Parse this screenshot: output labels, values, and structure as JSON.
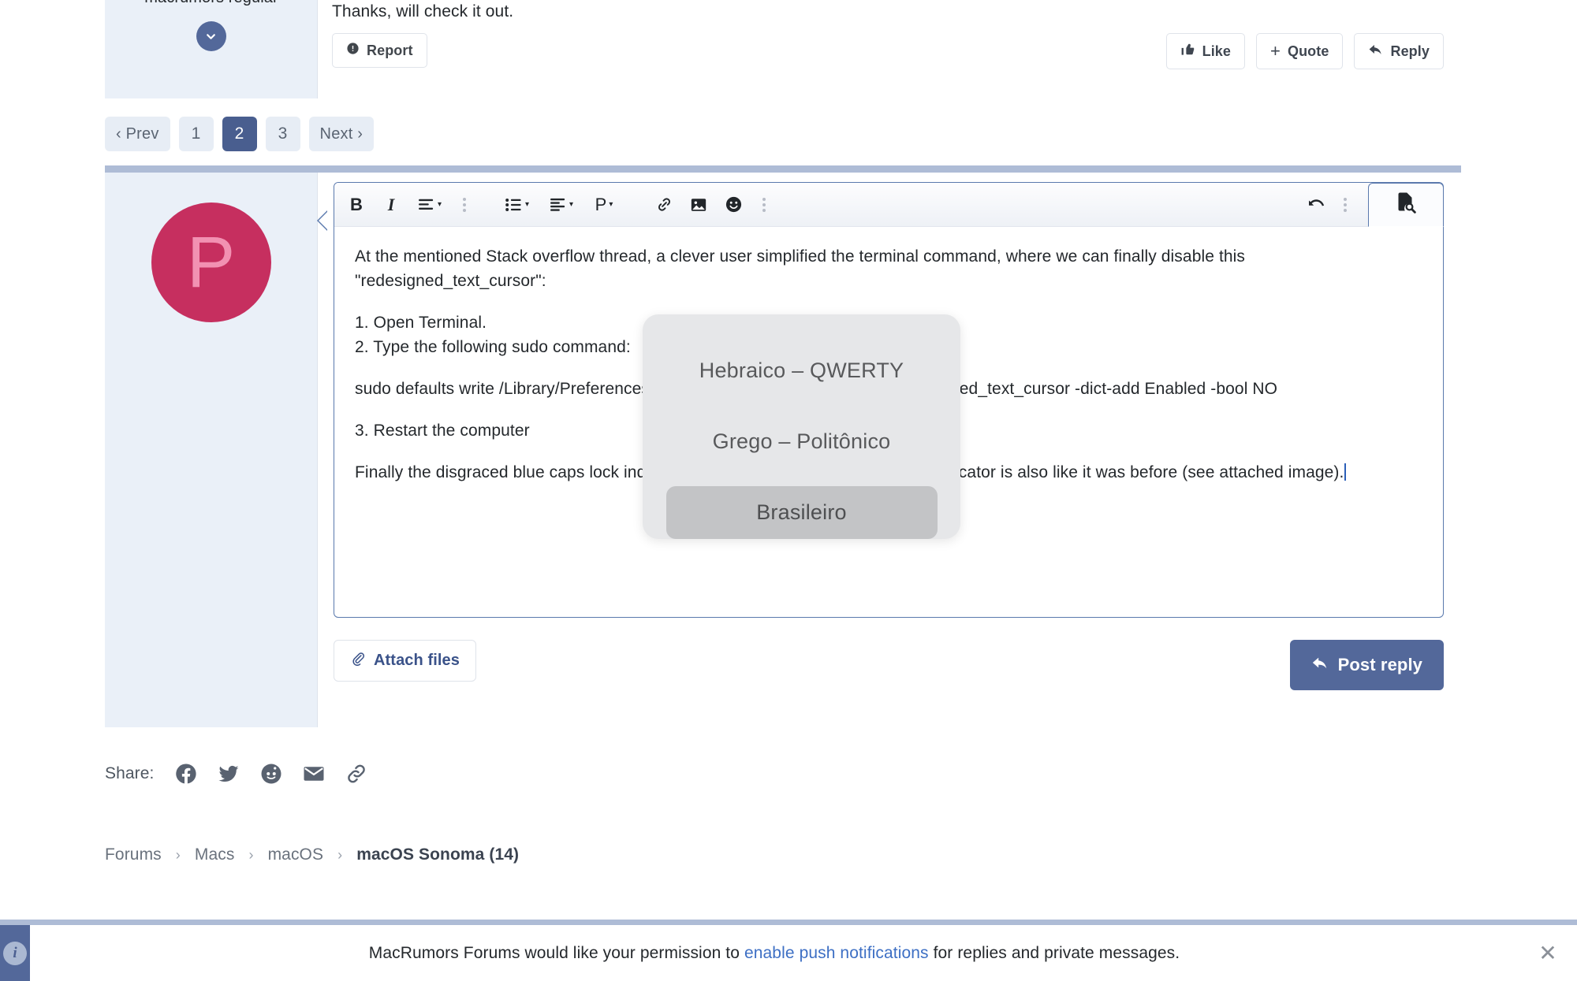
{
  "previous_post": {
    "username_clipped": "macrumors regular",
    "expand_icon": "chevron-down-icon",
    "body_text": "Thanks, will check it out.",
    "report_label": "Report",
    "report_icon": "exclamation-circle-icon",
    "actions": [
      {
        "label": "Like",
        "icon": "thumbs-up-icon"
      },
      {
        "label": "Quote",
        "icon": "plus-icon"
      },
      {
        "label": "Reply",
        "icon": "reply-arrow-icon"
      }
    ]
  },
  "pagination": {
    "prev_label": "‹ Prev",
    "pages": [
      "1",
      "2",
      "3"
    ],
    "current_page": "2",
    "next_label": "Next ›"
  },
  "reply": {
    "avatar_letter": "P",
    "avatar_bg": "#c62f5f",
    "avatar_fg": "#f291b2",
    "toolbar": {
      "bold": "B",
      "italic": "I",
      "bold_name": "bold-button",
      "italic_name": "italic-button",
      "text_format_icon": "text-lines-dropdown-icon",
      "more_left_icon": "more-options-icon",
      "list_icon": "bullet-list-dropdown-icon",
      "align_icon": "align-dropdown-icon",
      "paragraph_icon": "paragraph-dropdown-icon",
      "link_icon": "link-icon",
      "image_icon": "image-icon",
      "emoji_icon": "emoji-smiley-icon",
      "more_right_icon": "more-options-icon",
      "undo_icon": "undo-arrow-icon",
      "overflow_icon": "more-options-icon",
      "preview_icon": "document-preview-icon"
    },
    "content": {
      "p1": "At the mentioned Stack overflow thread, a clever user simplified the terminal command, where we can finally disable this \"redesigned_text_cursor\":",
      "p2_line1": "1. Open Terminal.",
      "p2_line2": "2. Type the following sudo command:",
      "p3": "sudo defaults write /Library/Preferences/FeatureFlags/Domain/UIKit.plist redesigned_text_cursor -dict-add Enabled -bool NO",
      "p4": "3. Restart the computer",
      "p5": "Finally the disgraced blue caps lock indicator is gone, and the keyboard swap indicator is also like it was before (see attached image)."
    },
    "attach_label": "Attach files",
    "attach_icon": "paperclip-icon",
    "post_label": "Post reply",
    "post_icon": "reply-arrow-icon",
    "post_button_color": "#53689a"
  },
  "keyboard_popup": {
    "items": [
      {
        "label": "Hebraico – QWERTY",
        "selected": false
      },
      {
        "label": "Grego – Politônico",
        "selected": false
      },
      {
        "label": "Brasileiro",
        "selected": true
      }
    ],
    "bg_color": "#e6e7e9",
    "selected_color": "#c3c4c6"
  },
  "share": {
    "label": "Share:",
    "icons": [
      "facebook-icon",
      "twitter-icon",
      "reddit-icon",
      "email-icon",
      "link-icon"
    ]
  },
  "breadcrumb": {
    "items": [
      "Forums",
      "Macs",
      "macOS",
      "macOS Sonoma (14)"
    ],
    "separator": "›",
    "current": "macOS Sonoma (14)"
  },
  "notification": {
    "info_icon": "info-icon",
    "text_before": "MacRumors Forums would like your permission to ",
    "link_text": "enable push notifications",
    "text_after": " for replies and private messages.",
    "close_icon": "close-icon",
    "accent_color": "#53689a",
    "link_color": "#3d6fc4"
  }
}
